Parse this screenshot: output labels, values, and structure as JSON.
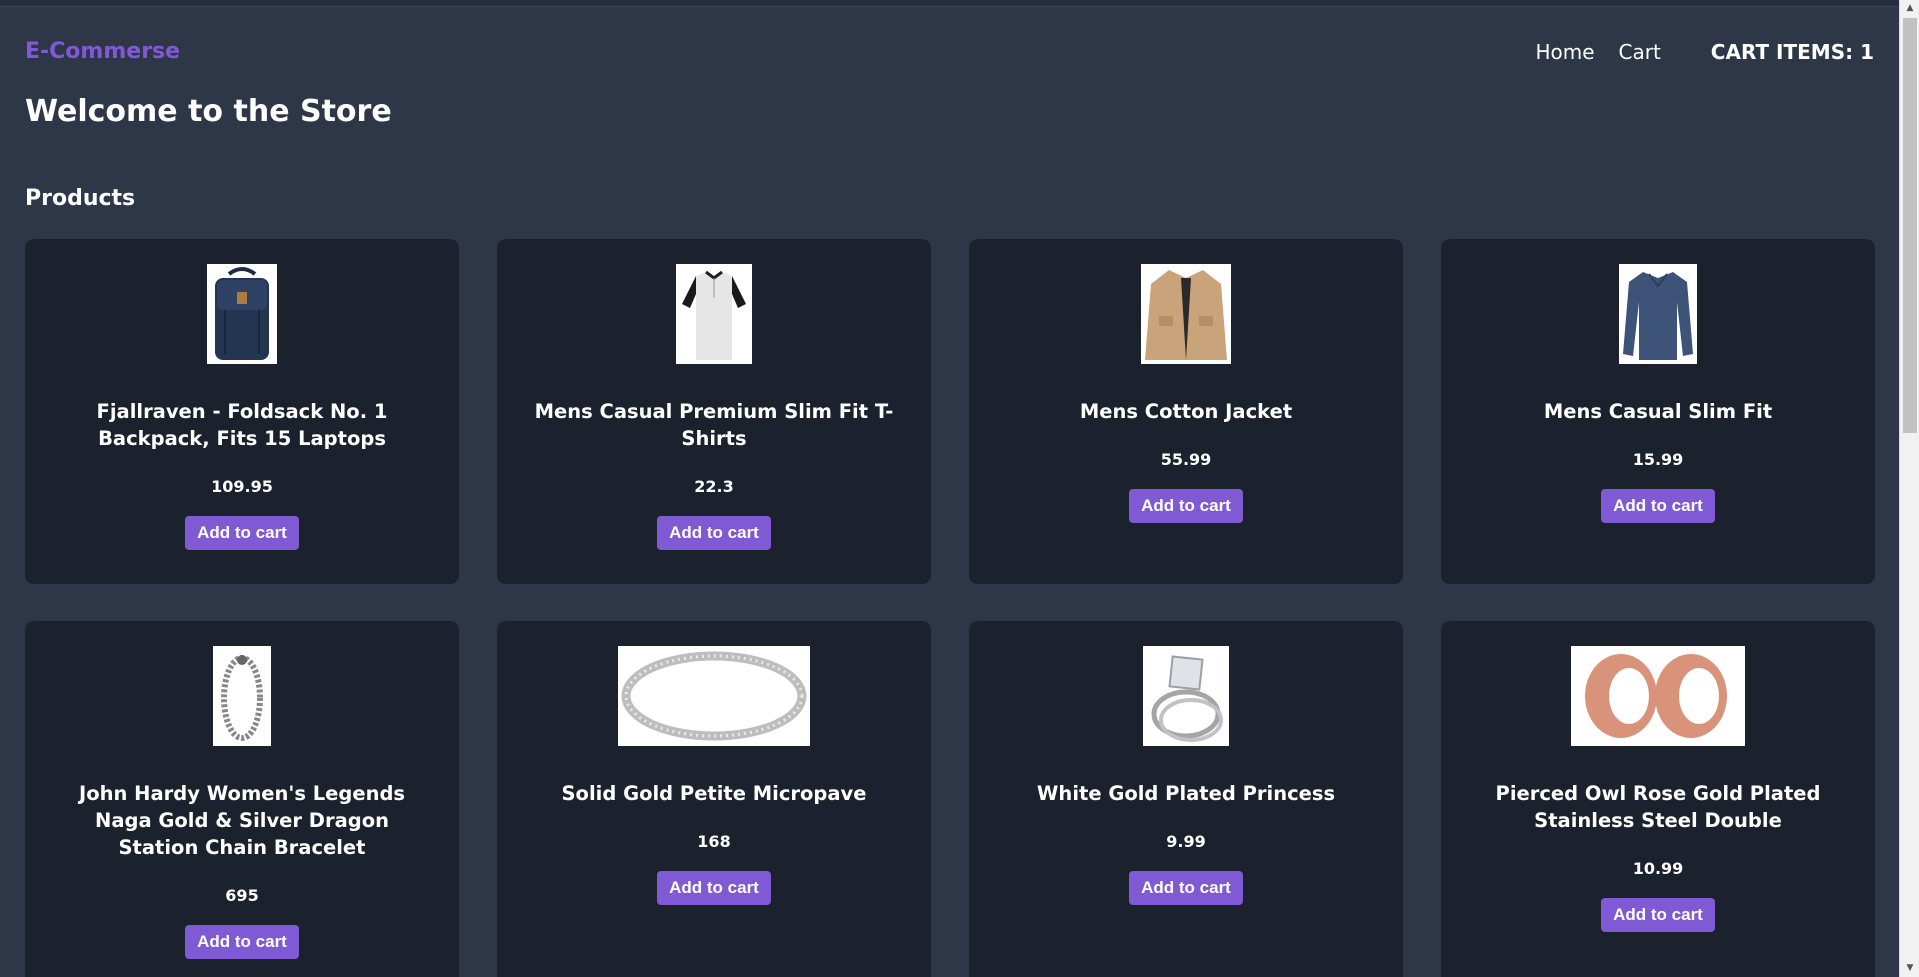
{
  "brand": "E-Commerse",
  "nav": {
    "home": "Home",
    "cart": "Cart",
    "cart_items": "CART ITEMS: 1"
  },
  "welcome": "Welcome to the Store",
  "section_title": "Products",
  "add_to_cart_label": "Add to cart",
  "colors": {
    "background": "#2d3748",
    "card": "#1c222d",
    "accent": "#805ad5"
  },
  "products": [
    {
      "title": "Fjallraven - Foldsack No. 1 Backpack, Fits 15 Laptops",
      "price": "109.95",
      "icon": "backpack-image"
    },
    {
      "title": "Mens Casual Premium Slim Fit T-Shirts",
      "price": "22.3",
      "icon": "tshirt-image"
    },
    {
      "title": "Mens Cotton Jacket",
      "price": "55.99",
      "icon": "jacket-image"
    },
    {
      "title": "Mens Casual Slim Fit",
      "price": "15.99",
      "icon": "longsleeve-shirt-image"
    },
    {
      "title": "John Hardy Women's Legends Naga Gold & Silver Dragon Station Chain Bracelet",
      "price": "695",
      "icon": "bracelet-image"
    },
    {
      "title": "Solid Gold Petite Micropave",
      "price": "168",
      "icon": "ring-band-image"
    },
    {
      "title": "White Gold Plated Princess",
      "price": "9.99",
      "icon": "diamond-ring-image"
    },
    {
      "title": "Pierced Owl Rose Gold Plated Stainless Steel Double",
      "price": "10.99",
      "icon": "rose-gold-plugs-image"
    }
  ]
}
